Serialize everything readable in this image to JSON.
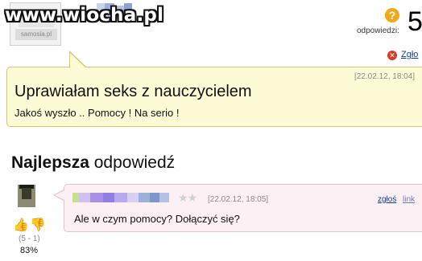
{
  "watermark": "www.wiocha.pl",
  "asker": {
    "logo_text": "samosia.pl"
  },
  "answers": {
    "label": "odpowiedzi:",
    "count": "5",
    "help_icon": "?"
  },
  "report_top": {
    "label": "Zgło",
    "icon": "close-circle-icon"
  },
  "question": {
    "date": "[22.02.12, 18:04]",
    "title": "Uprawiałam seks z nauczycielem",
    "body": "Jakoś wyszło .. Pomocy ! Na serio !"
  },
  "best_answer": {
    "heading_bold": "Najlepsza",
    "heading_rest": "odpowiedź",
    "date": "[22.02.12, 18:05]",
    "report_label": "zgłoś",
    "link_label": "link",
    "text": "Ale w czym pomocy? Dołączyć się?",
    "score": "(5 - 1)",
    "percent": "83%",
    "rating_stars": 0,
    "stars_glyph": "★★",
    "thumb_up_glyph": "👍",
    "thumb_down_glyph": "👎"
  },
  "colors": {
    "question_bg": "#fdfbd5",
    "answer_bg": "#fdf0f4",
    "link": "#0a3a9a",
    "badge": "#f0a71a"
  }
}
